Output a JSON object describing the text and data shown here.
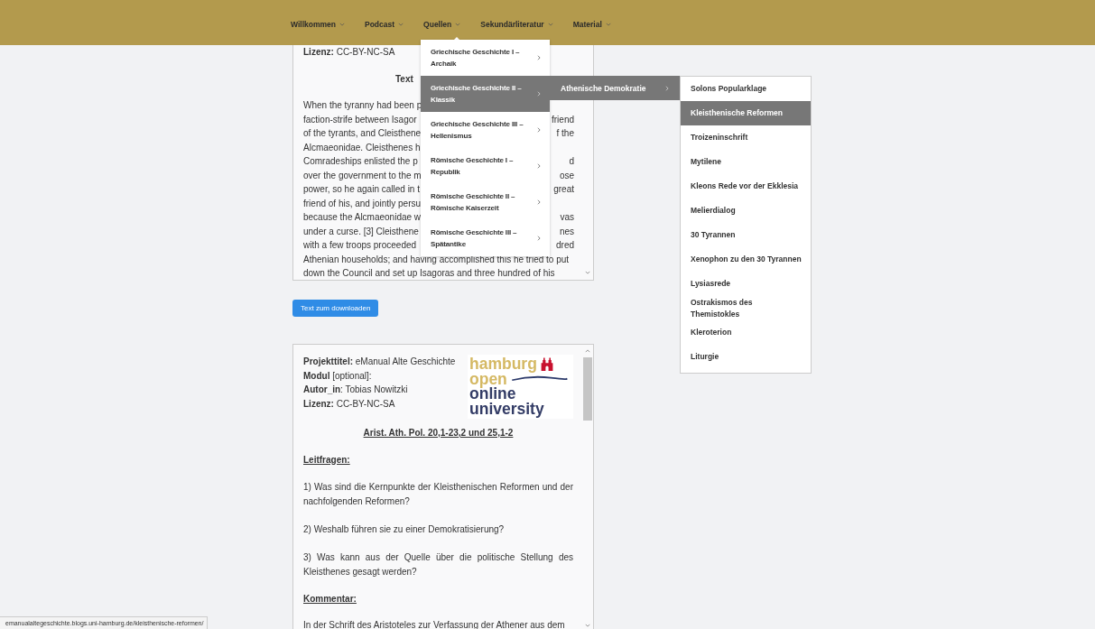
{
  "nav": {
    "items": [
      {
        "label": "Willkommen",
        "expanded": false
      },
      {
        "label": "Podcast",
        "expanded": false
      },
      {
        "label": "Quellen",
        "expanded": true
      },
      {
        "label": "Sekundärliteratur",
        "expanded": false
      },
      {
        "label": "Material",
        "expanded": false
      }
    ]
  },
  "source_box": {
    "license": "**Lizenz:** CC-BY-NC-SA",
    "heading": "Text",
    "lines": [
      {
        "left": "When the tyranny had been p"
      },
      {
        "left": "faction-strife between Isagor",
        "right": "friend"
      },
      {
        "left": "of the tyrants, and Cleisthene",
        "right": "f the"
      },
      {
        "left": "Alcmaeonidae. Cleisthenes h"
      },
      {
        "left": "Comradeships enlisted the p",
        "right": "d"
      },
      {
        "left": "over the government to the m",
        "right": "ose"
      },
      {
        "left": "power, so he again called in t",
        "right": "great"
      },
      {
        "left": "friend of his, and jointly persu"
      },
      {
        "left": "because the Alcmaeonidae w",
        "right": "vas"
      },
      {
        "left": "under a curse. [3] Cleisthene",
        "right": "nes"
      },
      {
        "left": "with a few troops proceeded",
        "right": "dred"
      },
      {
        "left": "Athenian households; and having accomplished this he tried to put"
      },
      {
        "left": "down the Council and set up Isagoras and three hundred of his"
      }
    ]
  },
  "download_button": "Text zum downloaden",
  "module_box": {
    "meta": [
      "**Projekttitel:** eManual Alte Geschichte",
      "**Modul** [optional]:",
      "**Autor_in**: Tobias Nowitzki",
      "**Lizenz:** CC-BY-NC-SA"
    ],
    "logo": {
      "lines": [
        "hamburg",
        "open",
        "online",
        "university"
      ]
    },
    "blocks": [
      {
        "kind": "title",
        "text": "Arist. Ath. Pol. 20,1-23,2 und 25,1-2"
      },
      {
        "kind": "heading",
        "text": "Leitfragen:"
      },
      {
        "kind": "paragraph",
        "text": "1) Was sind die Kernpunkte der Kleisthenischen Reformen und der nachfolgenden Reformen?"
      },
      {
        "kind": "paragraph",
        "text": "2) Weshalb führen sie zu einer Demokratisierung?"
      },
      {
        "kind": "paragraph",
        "text": "3) Was kann aus der Quelle über die politische Stellung des Kleisthenes gesagt werden?"
      },
      {
        "kind": "heading",
        "text": "Kommentar:"
      },
      {
        "kind": "line",
        "text": "In der Schrift des Aristoteles zur Verfassung der Athener aus dem"
      }
    ]
  },
  "quellen_menu": {
    "items": [
      {
        "label": "Griechische Geschichte I – Archaik",
        "selected": false
      },
      {
        "label": "Griechische Geschichte II – Klassik",
        "selected": true
      },
      {
        "label": "Griechische Geschichte III – Hellenismus",
        "selected": false
      },
      {
        "label": "Römische Geschichte I – Republik",
        "selected": false
      },
      {
        "label": "Römische Geschichte II – Römische Kaiserzeit",
        "selected": false
      },
      {
        "label": "Römische Geschichte III – Spätantike",
        "selected": false
      }
    ]
  },
  "submenu": {
    "items": [
      {
        "label": "Athenische Demokratie",
        "selected": true
      }
    ]
  },
  "topic_menu": {
    "items": [
      {
        "label": "Solons Popularklage",
        "selected": false
      },
      {
        "label": "Kleisthenische Reformen",
        "selected": true
      },
      {
        "label": "Troizeninschrift",
        "selected": false
      },
      {
        "label": "Mytilene",
        "selected": false
      },
      {
        "label": "Kleons Rede vor der Ekklesia",
        "selected": false
      },
      {
        "label": "Melierdialog",
        "selected": false
      },
      {
        "label": "30 Tyrannen",
        "selected": false
      },
      {
        "label": "Xenophon zu den 30 Tyrannen",
        "selected": false
      },
      {
        "label": "Lysiasrede",
        "selected": false
      },
      {
        "label": "Ostrakismos des Themistokles",
        "selected": false
      },
      {
        "label": "Kleroterion",
        "selected": false
      },
      {
        "label": "Liturgie",
        "selected": false
      }
    ]
  },
  "status_bar": {
    "url": "emanualaltegeschichte.blogs.uni-hamburg.de/kleisthenische-reformen/"
  }
}
